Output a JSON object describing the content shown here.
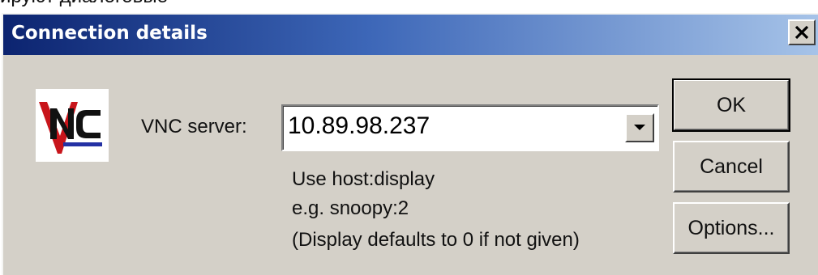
{
  "caption": "ируют диалоговые",
  "dialog": {
    "title": "Connection details",
    "close_glyph": "×",
    "accent_color": "#0c2470"
  },
  "form": {
    "server_label": "VNC server:",
    "server_value": "10.89.98.237",
    "hint_line_1": "Use host:display",
    "hint_line_2": "e.g. snoopy:2",
    "hint_line_3": "(Display defaults to 0 if not given)"
  },
  "buttons": {
    "ok": "OK",
    "cancel": "Cancel",
    "options": "Options..."
  },
  "logo": {
    "text": "VNC",
    "icon": "vnc-logo-icon"
  }
}
